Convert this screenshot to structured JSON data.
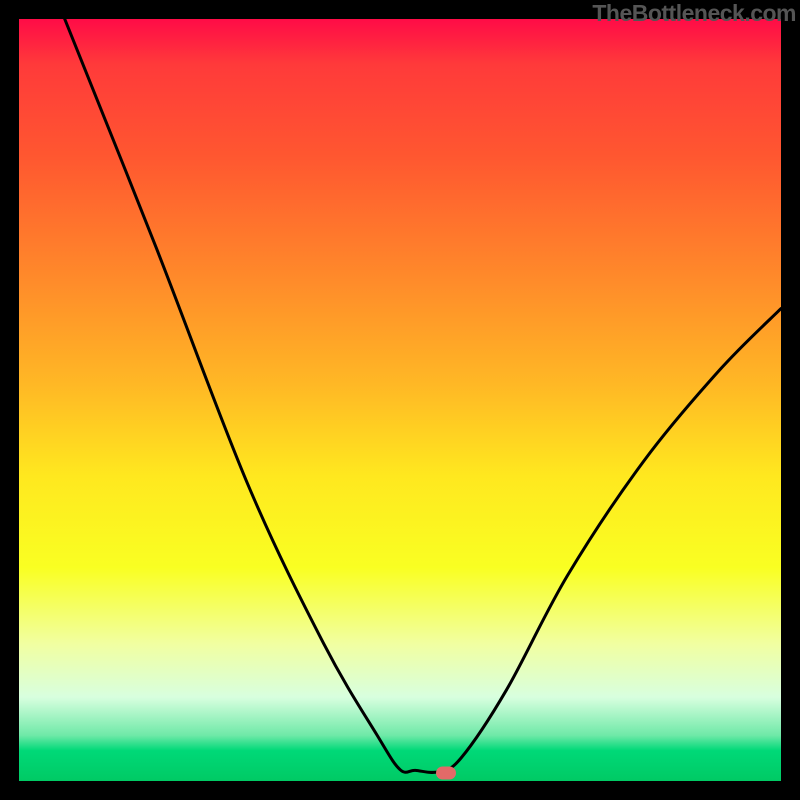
{
  "attribution": "TheBottleneck.com",
  "chart_data": {
    "type": "line",
    "title": "",
    "xlabel": "",
    "ylabel": "",
    "xlim": [
      0,
      100
    ],
    "ylim": [
      0,
      100
    ],
    "curve_points": [
      {
        "x": 6,
        "y": 100
      },
      {
        "x": 18,
        "y": 70
      },
      {
        "x": 30,
        "y": 39
      },
      {
        "x": 40,
        "y": 18
      },
      {
        "x": 47,
        "y": 6
      },
      {
        "x": 50,
        "y": 1.5
      },
      {
        "x": 52,
        "y": 1.4
      },
      {
        "x": 55,
        "y": 1.2
      },
      {
        "x": 58,
        "y": 3
      },
      {
        "x": 64,
        "y": 12
      },
      {
        "x": 72,
        "y": 27
      },
      {
        "x": 82,
        "y": 42
      },
      {
        "x": 92,
        "y": 54
      },
      {
        "x": 100,
        "y": 62
      }
    ],
    "marker": {
      "x": 56,
      "y": 1.0,
      "color": "#e26a68"
    },
    "gradient_stops": [
      {
        "pos": 0,
        "color": "#ff0b47"
      },
      {
        "pos": 0.25,
        "color": "#ff7a2a"
      },
      {
        "pos": 0.55,
        "color": "#ffe81f"
      },
      {
        "pos": 0.85,
        "color": "#e8ffc0"
      },
      {
        "pos": 1.0,
        "color": "#00ca64"
      }
    ]
  }
}
